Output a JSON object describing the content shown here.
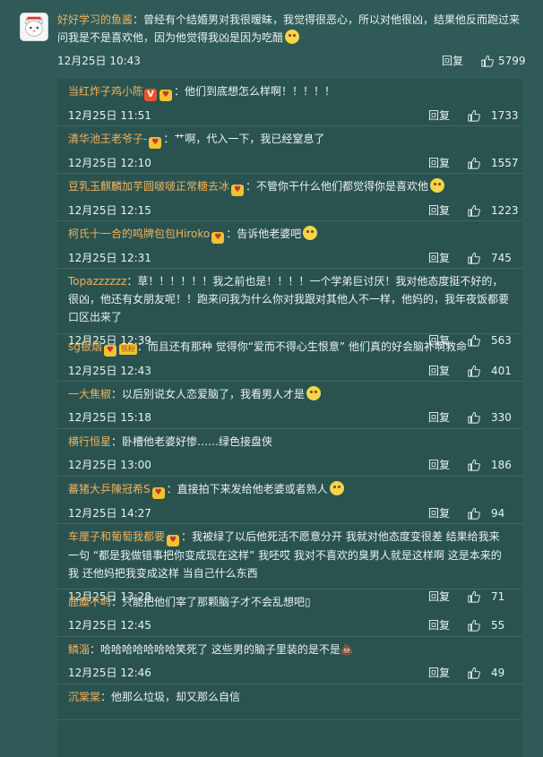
{
  "main_comment": {
    "user": "好好学习的鱼酱",
    "text": "：曾经有个结婚男对我很暧昧，我觉得很恶心，所以对他很凶，结果他反而跑过来问我是不是喜欢他，因为他觉得我凶是因为吃醋",
    "emoji": "smile-emoji",
    "time": "12月25日 10:43",
    "reply_label": "回复",
    "likes": "5799"
  },
  "replies": [
    {
      "user": "当红炸子鸡小陈",
      "badges": [
        "v",
        "fan"
      ],
      "text": "：他们到底想怎么样啊！！！！！",
      "time": "12月25日 11:51",
      "likes": "1733"
    },
    {
      "user": "清华池王老爷子-",
      "badges": [
        "fan"
      ],
      "text": "：艹啊，代入一下，我已经窒息了",
      "time": "12月25日 12:10",
      "likes": "1557"
    },
    {
      "user": "豆乳玉麒麟加芋圆啵啵正常糖去冰",
      "badges": [
        "fan"
      ],
      "text": "：不管你干什么他们都觉得你是喜欢他",
      "emoji": "smile-emoji",
      "time": "12月25日 12:15",
      "likes": "1223"
    },
    {
      "user": "柯氏十一合的鸣牌包包Hiroko",
      "badges": [
        "fan"
      ],
      "text": "：告诉他老婆吧",
      "emoji": "cry-emoji",
      "time": "12月25日 12:31",
      "likes": "745"
    },
    {
      "user": "Topazzzzzz",
      "badges": [],
      "text": "：草！！！！！！我之前也是！！！！一个学弟巨讨厌！我对他态度挺不好的，很凶，他还有女朋友呢！！跑来问我为什么你对我跟对其他人不一样，他妈的，我年夜饭都要口区出来了",
      "time": "12月25日 12:39",
      "likes": "563"
    },
    {
      "user": "sg银烟",
      "badges": [
        "fan",
        "fan-tag"
      ],
      "text": "：而且还有那种 觉得你“爱而不得心生恨意” 他们真的好会脑补啊救命",
      "time": "12月25日 12:43",
      "likes": "401"
    },
    {
      "user": "一大焦椒",
      "badges": [],
      "text": "：以后别说女人恋爱脑了，我看男人才是",
      "emoji": "laugh-emoji",
      "time": "12月25日 15:18",
      "likes": "330"
    },
    {
      "user": "横行恒星",
      "badges": [],
      "text": "：卧槽他老婆好惨……绿色接盘侠",
      "time": "12月25日 13:00",
      "likes": "186"
    },
    {
      "user": "蕃猪大乒陳冠希S",
      "badges": [
        "fan"
      ],
      "text": "：直接拍下来发给他老婆或者熟人",
      "emoji": "grin-emoji",
      "time": "12月25日 14:27",
      "likes": "94"
    },
    {
      "user": "车厘子和葡萄我都要",
      "badges": [
        "fan"
      ],
      "text": "：我被绿了以后他死活不愿意分开 我就对他态度变很差 结果给我来一句 “都是我做错事把你变成现在这样” 我呸哎 我对不喜欢的臭男人就是这样啊 这是本来的我 还他妈把我变成这样 当自己什么东西",
      "time": "12月25日 13:28",
      "likes": "71"
    },
    {
      "user": "鹿麋不屿",
      "badges": [],
      "text": "：只能把他们宰了那颗脑子才不会乱想吧▯",
      "time": "12月25日 12:45",
      "likes": "55"
    },
    {
      "user": "鳞淄",
      "badges": [],
      "text": "：哈哈哈哈哈哈哈笑死了 这些男的脑子里装的是不是💩",
      "time": "12月25日 12:46",
      "likes": "49"
    },
    {
      "user": "沉棠棠",
      "badges": [],
      "text": "：他那么垃圾，却又那么自信",
      "time": "",
      "likes": ""
    }
  ],
  "labels": {
    "reply": "回复",
    "badge_v": "V",
    "badge_fan_tag": "铁粉"
  },
  "colors": {
    "background": "#2f5a57",
    "username": "#f0b25c",
    "text": "#eaf2f1"
  }
}
